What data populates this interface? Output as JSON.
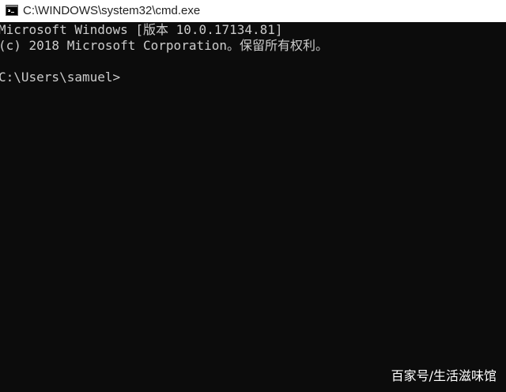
{
  "window": {
    "title": "C:\\WINDOWS\\system32\\cmd.exe",
    "icon": "cmd-console-icon"
  },
  "console": {
    "lines": [
      "Microsoft Windows [版本 10.0.17134.81]",
      "(c) 2018 Microsoft Corporation。保留所有权利。",
      "C:\\Users\\samuel>"
    ]
  },
  "watermark": {
    "text": "百家号/生活滋味馆"
  },
  "colors": {
    "console_bg": "#0c0c0c",
    "console_text": "#cccccc",
    "titlebar_bg": "#ffffff"
  }
}
